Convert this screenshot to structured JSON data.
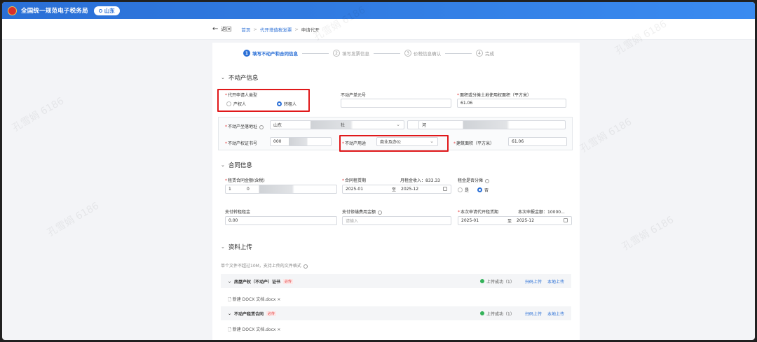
{
  "header": {
    "site_title": "全国统一规范电子税务局",
    "region": "山东"
  },
  "crumbs": {
    "back": "返回",
    "home": "首页",
    "parent": "代开增值税发票",
    "current": "申请代开"
  },
  "steps": [
    {
      "n": "1",
      "label": "填写不动产和合同信息"
    },
    {
      "n": "2",
      "label": "填写发票信息"
    },
    {
      "n": "3",
      "label": "价税信息确认"
    },
    {
      "n": "4",
      "label": "完成"
    }
  ],
  "property": {
    "title": "不动产信息",
    "applicant_type_label": "代开申请人类型",
    "opt_owner": "产权人",
    "opt_lessor": "转租人",
    "unit_no_label": "不动产单元号",
    "unit_no": "",
    "land_area_label": "面积或分摊土地使用权面积（平方米）",
    "land_area": "61.06",
    "address_label": "不动产坐落地址",
    "address_prov": "山东",
    "address_suffix": "社",
    "address_extra": "河",
    "cert_label": "不动产权证书号",
    "cert_no": "000",
    "use_label": "不动产用途",
    "use_value": "商业及办公",
    "build_area_label": "建筑面积（平方米）",
    "build_area": "61.06"
  },
  "contract": {
    "title": "合同信息",
    "total_rent_label": "租赁合同金额(含税)",
    "total_rent": "1",
    "total_rent_tail": "0",
    "period_label": "合同租赁期",
    "monthly_label": "月租金收入：833.33",
    "period_from": "2025-01",
    "period_to": "2025-12",
    "to": "至",
    "split_label": "租金是否分摊",
    "yes": "是",
    "no": "否",
    "paid_label": "支付转租租金",
    "paid": "0.00",
    "fee_label": "支付修缮费用金额",
    "fee_ph": "请输入",
    "this_period_label": "本次申请代开租赁期",
    "this_rent_label": "本次申报金额：10000...",
    "this_from": "2025-01",
    "this_to": "2025-12"
  },
  "upload": {
    "title": "资料上传",
    "note": "单个文件不超过10M，支持上传的文件格式",
    "groups": [
      {
        "name": "房屋产权（不动产）证书",
        "must": "必传",
        "status": "上传成功（1）",
        "scan": "扫码上传",
        "local": "本地上传",
        "file": "新建 DOCX 文档.docx"
      },
      {
        "name": "不动产租赁合同",
        "must": "必传",
        "status": "上传成功（1）",
        "scan": "扫码上传",
        "local": "本地上传",
        "file": "新建 DOCX 文档.docx"
      }
    ]
  },
  "colors": {
    "primary": "#2a6fd6",
    "highlight": "#e0181a"
  }
}
